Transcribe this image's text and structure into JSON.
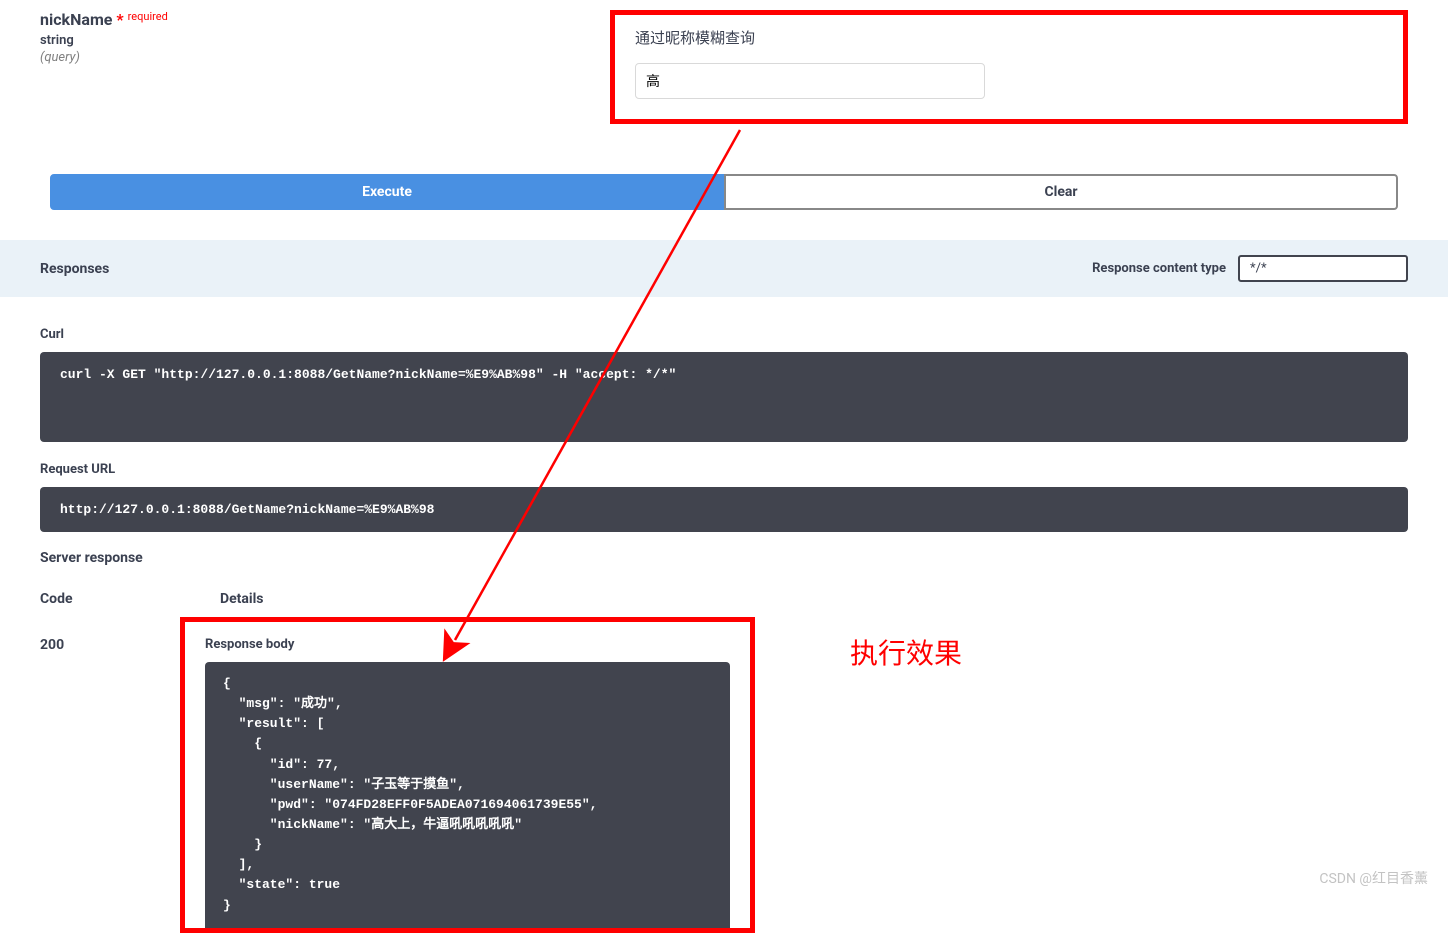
{
  "param": {
    "name": "nickName",
    "required_text": "required",
    "type": "string",
    "in": "(query)",
    "description": "通过昵称模糊查询",
    "value": "高"
  },
  "buttons": {
    "execute": "Execute",
    "clear": "Clear"
  },
  "responses_header": {
    "title": "Responses",
    "content_type_label": "Response content type",
    "content_type_value": "*/*"
  },
  "curl": {
    "label": "Curl",
    "text": "curl -X GET \"http://127.0.0.1:8088/GetName?nickName=%E9%AB%98\" -H \"accept: */*\""
  },
  "request_url": {
    "label": "Request URL",
    "text": "http://127.0.0.1:8088/GetName?nickName=%E9%AB%98"
  },
  "server_response": {
    "label": "Server response",
    "code_header": "Code",
    "details_header": "Details",
    "code": "200",
    "body_label": "Response body",
    "body": "{\n  \"msg\": \"成功\",\n  \"result\": [\n    {\n      \"id\": 77,\n      \"userName\": \"子玉等于摸鱼\",\n      \"pwd\": \"074FD28EFF0F5ADEA071694061739E55\",\n      \"nickName\": \"高大上，牛逼吼吼吼吼吼\"\n    }\n  ],\n  \"state\": true\n}"
  },
  "annotation": "执行效果",
  "watermark": "CSDN @红目香薰"
}
